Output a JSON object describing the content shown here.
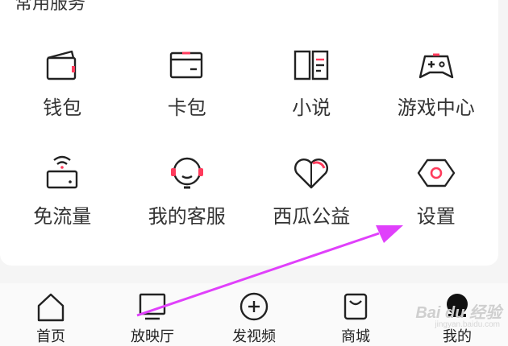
{
  "header": {
    "section_title": "常用服务"
  },
  "services": [
    {
      "label": "钱包",
      "icon": "wallet-icon"
    },
    {
      "label": "卡包",
      "icon": "card-wallet-icon"
    },
    {
      "label": "小说",
      "icon": "book-icon"
    },
    {
      "label": "游戏中心",
      "icon": "gamepad-icon"
    },
    {
      "label": "免流量",
      "icon": "free-data-icon"
    },
    {
      "label": "我的客服",
      "icon": "headset-icon"
    },
    {
      "label": "西瓜公益",
      "icon": "heart-icon"
    },
    {
      "label": "设置",
      "icon": "settings-hexagon-icon"
    }
  ],
  "tabbar": [
    {
      "label": "首页",
      "icon": "home-icon"
    },
    {
      "label": "放映厅",
      "icon": "tv-icon"
    },
    {
      "label": "发视频",
      "icon": "add-video-icon"
    },
    {
      "label": "商城",
      "icon": "shopping-bag-icon"
    },
    {
      "label": "我的",
      "icon": "profile-avatar-icon"
    }
  ],
  "watermark": {
    "text": "Bai du 经验",
    "sub": "jingyan.baidu.com"
  },
  "colors": {
    "accent": "#ff3b5c",
    "arrow": "#e040fb",
    "icon_stroke": "#222222"
  }
}
